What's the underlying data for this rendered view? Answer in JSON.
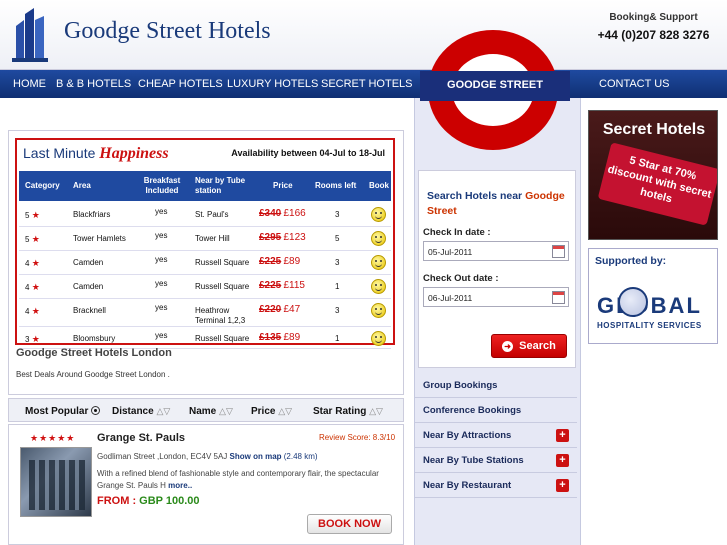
{
  "header": {
    "brand": "Goodge Street Hotels",
    "support_label": "Booking& Support",
    "support_phone": "+44 (0)207 828 3276"
  },
  "nav": {
    "items": [
      "HOME",
      "B & B HOTELS",
      "CHEAP HOTELS",
      "LUXURY HOTELS",
      "SECRET HOTELS",
      "CONTACT US"
    ]
  },
  "roundel": {
    "label": "GOODGE STREET"
  },
  "last_minute": {
    "title_plain": "Last Minute",
    "title_script": "Happiness",
    "availability": "Availability between 04-Jul to 18-Jul",
    "columns": [
      "Category",
      "Area",
      "Breakfast Included",
      "Near by Tube station",
      "Price",
      "Rooms left",
      "Book"
    ],
    "rows": [
      {
        "category": "5",
        "area": "Blackfriars",
        "breakfast": "yes",
        "tube": "St. Paul's",
        "old_price": "£340",
        "new_price": "£166",
        "rooms": "3"
      },
      {
        "category": "5",
        "area": "Tower Hamlets",
        "breakfast": "yes",
        "tube": "Tower Hill",
        "old_price": "£295",
        "new_price": "£123",
        "rooms": "5"
      },
      {
        "category": "4",
        "area": "Camden",
        "breakfast": "yes",
        "tube": "Russell Square",
        "old_price": "£225",
        "new_price": "£89",
        "rooms": "3"
      },
      {
        "category": "4",
        "area": "Camden",
        "breakfast": "yes",
        "tube": "Russell Square",
        "old_price": "£225",
        "new_price": "£115",
        "rooms": "1"
      },
      {
        "category": "4",
        "area": "Bracknell",
        "breakfast": "yes",
        "tube": "Heathrow Terminal 1,2,3",
        "old_price": "£220",
        "new_price": "£47",
        "rooms": "3"
      },
      {
        "category": "3",
        "area": "Bloomsbury",
        "breakfast": "yes",
        "tube": "Russell Square",
        "old_price": "£135",
        "new_price": "£89",
        "rooms": "1"
      }
    ]
  },
  "intro": {
    "title": "Goodge Street Hotels London",
    "subtitle": "Best Deals Around Goodge Street London ."
  },
  "sort": {
    "most_popular": "Most Popular",
    "distance": "Distance",
    "name": "Name",
    "price": "Price",
    "star_rating": "Star Rating"
  },
  "hotel": {
    "stars": "★★★★★",
    "name": "Grange St. Pauls",
    "review": "Review Score: 8.3/10",
    "address": "Godliman Street ,London, EC4V 5AJ",
    "show_on_map": "Show on map",
    "distance": "(2.48 km)",
    "description": "With a refined blend of fashionable style and contemporary flair, the spectacular Grange St. Pauls H",
    "more": "more..",
    "from_label": "FROM :",
    "from_price": "GBP 100.00",
    "book_label": "BOOK NOW"
  },
  "search": {
    "title_prefix": "Search Hotels near",
    "title_highlight": "Goodge Street",
    "checkin_label": "Check In date :",
    "checkin_value": "05-Jul-2011",
    "checkout_label": "Check Out date :",
    "checkout_value": "06-Jul-2011",
    "button": "Search"
  },
  "side_links": [
    {
      "label": "Group Bookings",
      "plus": false
    },
    {
      "label": "Conference Bookings",
      "plus": false
    },
    {
      "label": "Near By Attractions",
      "plus": true
    },
    {
      "label": "Near By Tube Stations",
      "plus": true
    },
    {
      "label": "Near By Restaurant",
      "plus": true
    }
  ],
  "ads": {
    "secret_title": "Secret Hotels",
    "secret_tag": "5 Star at 70% discount with secret hotels",
    "supported_by": "Supported by:",
    "global_word": "GLOBAL",
    "global_sub": "HOSPITALITY SERVICES"
  },
  "colors": {
    "nav_blue": "#1f4aa0",
    "accent_red": "#cc1111",
    "panel_lavender": "#e6e8f5"
  }
}
